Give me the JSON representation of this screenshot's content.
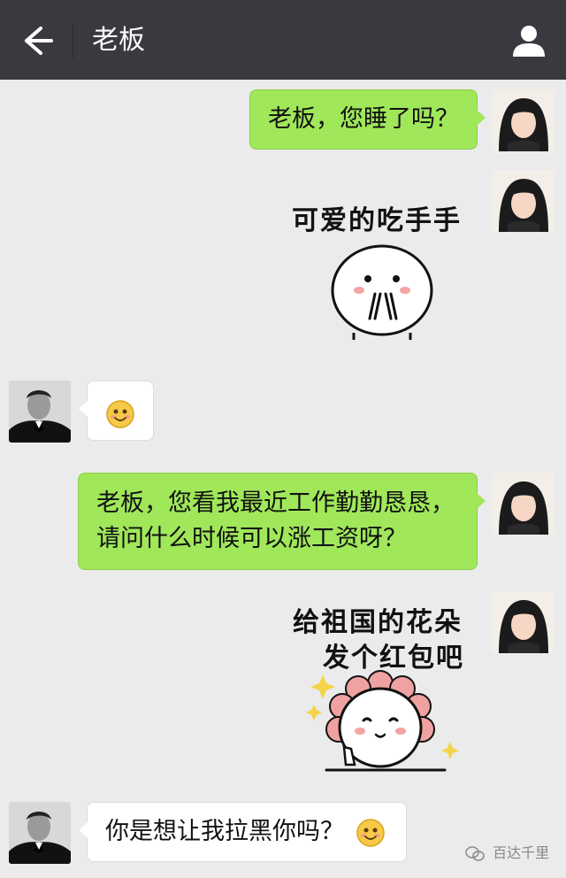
{
  "header": {
    "title": "老板"
  },
  "messages": [
    {
      "side": "right",
      "type": "text",
      "text": "老板，您睡了吗？"
    },
    {
      "side": "right",
      "type": "sticker",
      "caption": "可爱的吃手手"
    },
    {
      "side": "left",
      "type": "emoji",
      "emoji": "smile-icon"
    },
    {
      "side": "right",
      "type": "text",
      "line1": "老板，您看我最近工作勤勤恳恳，",
      "line2": "请问什么时候可以涨工资呀？"
    },
    {
      "side": "right",
      "type": "sticker",
      "caption_line1": "给祖国的花朵",
      "caption_line2": "发个红包吧"
    },
    {
      "side": "left",
      "type": "text",
      "text": "你是想让我拉黑你吗？",
      "emoji": "smile-icon"
    }
  ],
  "watermark": "百达千里",
  "colors": {
    "header_bg": "#393a3f",
    "chat_bg": "#ebebeb",
    "my_bubble": "#a0e75a",
    "their_bubble": "#ffffff"
  }
}
